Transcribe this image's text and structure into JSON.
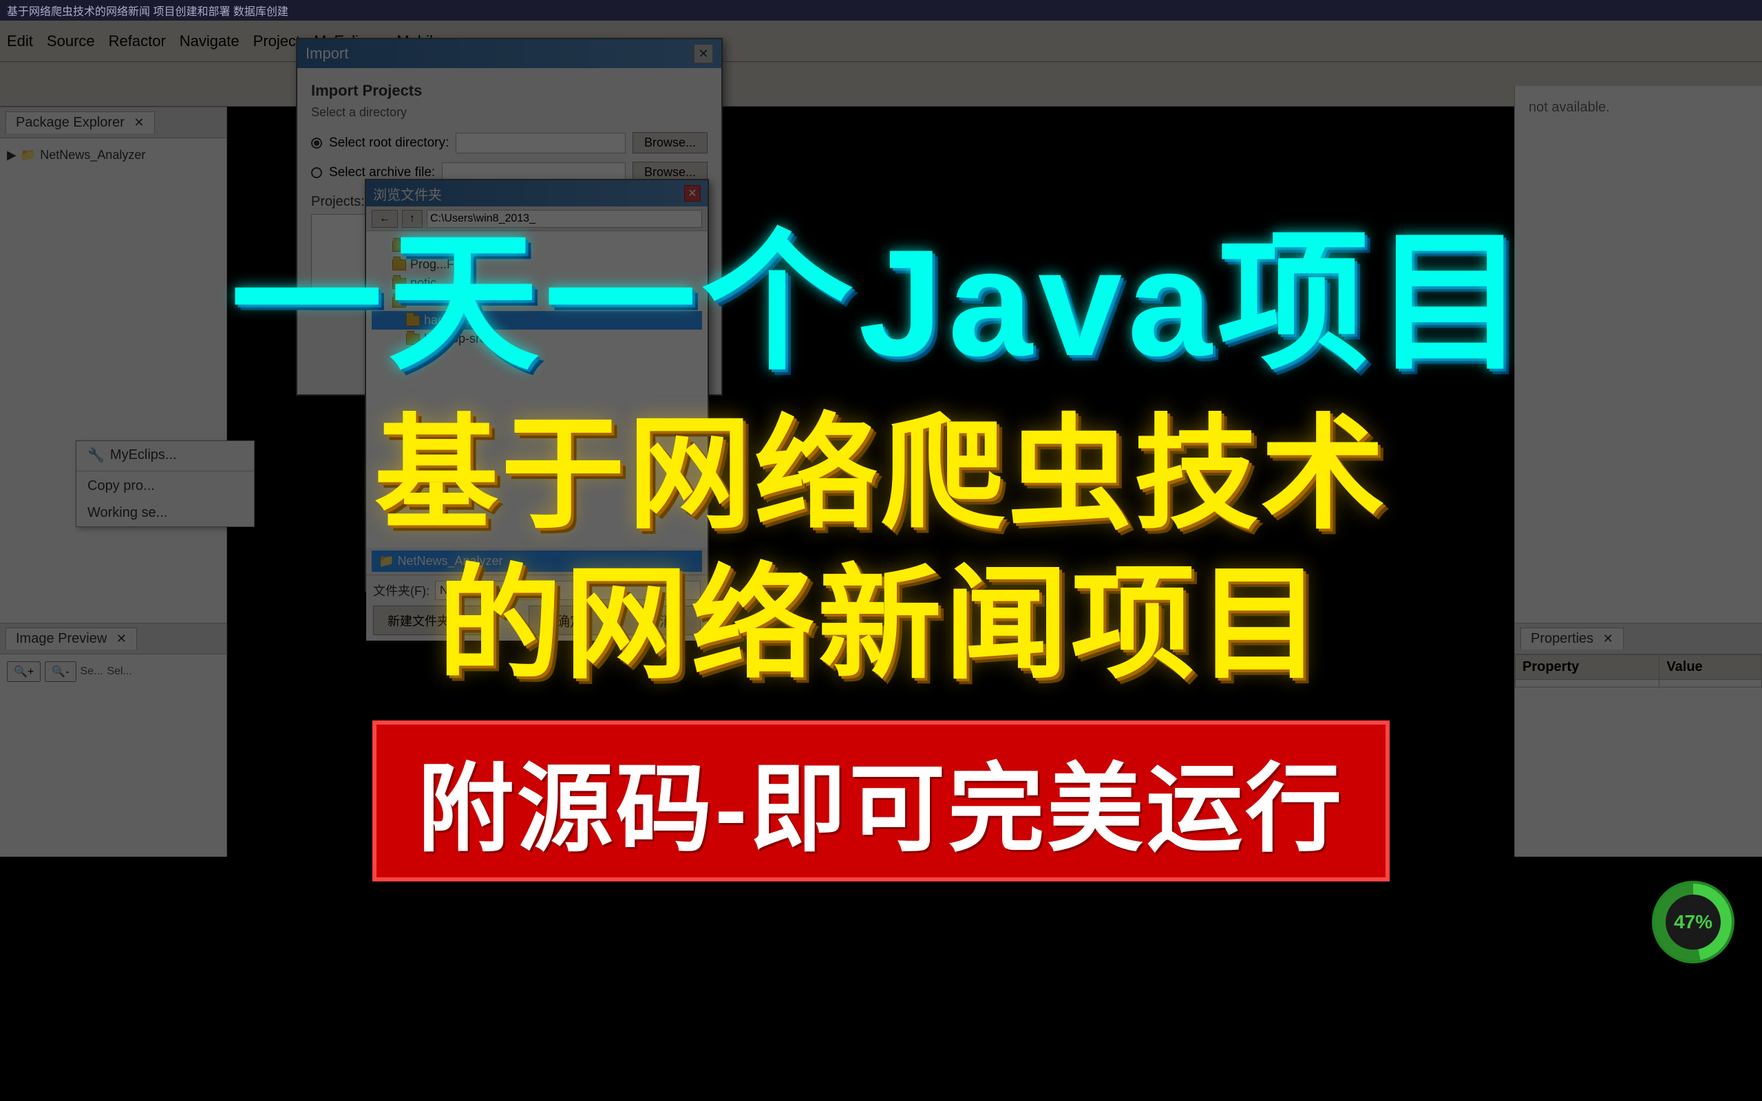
{
  "window": {
    "title": "基于网络爬虫技术的网络新闻 项目创建和部署 数据库创建",
    "titlebar_bg": "#1a1a2e"
  },
  "menubar": {
    "items": [
      "Edit",
      "Source",
      "Refactor",
      "Navigate",
      "Project",
      "MyEclipse",
      "Mobile"
    ]
  },
  "panels": {
    "package_explorer": {
      "tab_label": "Package Explorer"
    },
    "image_preview": {
      "tab_label": "Image Preview"
    },
    "properties": {
      "tab_label": "Properties",
      "columns": [
        "Property",
        "Value"
      ]
    }
  },
  "dialog_import": {
    "title": "Import",
    "section_title": "Import Projects",
    "subtitle": "Select a directory",
    "radio_root": "Select root directory:",
    "radio_archive": "Select archive file:",
    "browse_label": "Browse...",
    "projects_label": "Projects:",
    "close_symbol": "✕"
  },
  "dialog_filebrowser": {
    "title": "浏览文件夹",
    "close_symbol": "✕",
    "path_hint": "C:\\Users\\win8_2013_",
    "items": [
      {
        "name": "MyDrivers",
        "type": "folder",
        "indent": 1
      },
      {
        "name": "Prog...Files",
        "type": "folder",
        "indent": 1
      },
      {
        "name": "notic...",
        "type": "folder",
        "indent": 1
      },
      {
        "name": "wo...",
        "type": "folder",
        "indent": 1
      },
      {
        "name": "hadoop01",
        "type": "folder",
        "indent": 2,
        "selected": true
      },
      {
        "name": "hadoop-src",
        "type": "folder",
        "indent": 2
      }
    ],
    "filename_label": "文件夹(F):",
    "filename_value": "NetNews_Analyzer",
    "btn_new_dir": "新建文件夹(M)",
    "btn_confirm": "确定",
    "btn_cancel": "取消"
  },
  "context_menu": {
    "items": [
      {
        "label": "MyEclips...",
        "has_icon": true
      },
      {
        "label": "Copy pro...",
        "has_icon": false
      },
      {
        "label": "Working se...",
        "has_icon": false
      }
    ]
  },
  "overlay": {
    "title_line1": "一天一个Java项目",
    "title_line2": "基于网络爬虫技术",
    "title_line3": "的网络新闻项目",
    "subtitle": "附源码-即可完美运行"
  },
  "status": {
    "percent": "47%",
    "color_active": "#44cc44",
    "color_inactive": "#2a8a2a"
  },
  "access_panel": {
    "message": "not available."
  }
}
